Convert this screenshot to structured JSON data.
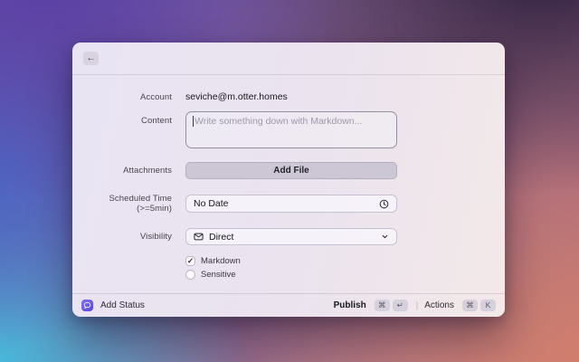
{
  "window": {
    "icons": {
      "back": "←",
      "chevron_down": "⌄",
      "check": "✓"
    }
  },
  "form": {
    "account": {
      "label": "Account",
      "value": "seviche@m.otter.homes"
    },
    "content": {
      "label": "Content",
      "placeholder": "Write something down with Markdown..."
    },
    "attachments": {
      "label": "Attachments",
      "button_label": "Add File"
    },
    "scheduled": {
      "label": "Scheduled Time (>=5min)",
      "value": "No Date"
    },
    "visibility": {
      "label": "Visibility",
      "value": "Direct"
    },
    "options": [
      {
        "label": "Markdown",
        "checked": true,
        "mark": "✓"
      },
      {
        "label": "Sensitive",
        "checked": false,
        "mark": ""
      }
    ]
  },
  "footer": {
    "title": "Add Status",
    "publish": {
      "label": "Publish",
      "keys": [
        "⌘",
        "↵"
      ]
    },
    "divider": "|",
    "actions": {
      "label": "Actions",
      "keys": [
        "⌘",
        "K"
      ]
    }
  },
  "colors": {
    "accent_app_icon": "#6a5ce8",
    "window_bg_left": "#e9e4f4",
    "window_bg_right": "#f3e9e9",
    "bg_purple": "#5b41a4",
    "bg_dark_purple": "#2e2040",
    "bg_blue": "#4668c8",
    "bg_cyan": "#40c6e4",
    "bg_salmon": "#d47d6a"
  }
}
